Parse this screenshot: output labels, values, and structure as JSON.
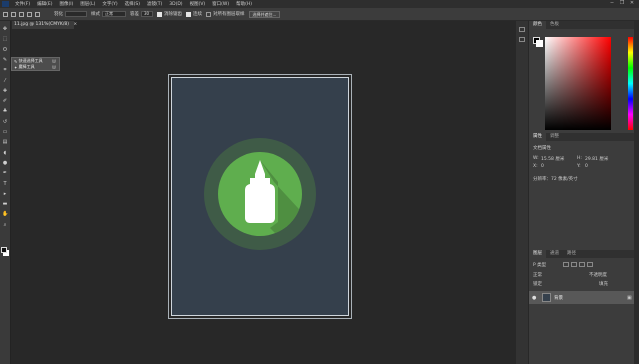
{
  "menubar": {
    "logo": "Ps",
    "items": [
      "文件(F)",
      "编辑(E)",
      "图像(I)",
      "图层(L)",
      "文字(Y)",
      "选择(S)",
      "滤镜(T)",
      "3D(D)",
      "视图(V)",
      "窗口(W)",
      "帮助(H)"
    ],
    "window_controls": [
      "─",
      "❐",
      "✕"
    ]
  },
  "options": {
    "style_label": "正常",
    "size_value": "30",
    "check1_label": "消除锯齿",
    "check2_label": "连续",
    "check3_label": "对所有图层取样",
    "button_label": "选择并遮住..."
  },
  "document": {
    "tab_title": "11.jpg @ 131%(CMYK/8)",
    "close": "×"
  },
  "tool_flyout": {
    "items": [
      {
        "label": "快速选择工具",
        "shortcut": "W"
      },
      {
        "label": "魔棒工具",
        "shortcut": "W"
      }
    ]
  },
  "panels": {
    "color_tabs": [
      "颜色",
      "色板"
    ],
    "properties_tabs": [
      "属性",
      "调整"
    ],
    "properties": {
      "section": "文档属性",
      "w_label": "W:",
      "w_value": "15.58 厘米",
      "h_label": "H:",
      "h_value": "29.81 厘米",
      "x_label": "X:",
      "x_value": "0",
      "y_label": "Y:",
      "y_value": "0",
      "resolution": "分辨率：72 像素/英寸"
    },
    "layers_tabs": [
      "图层",
      "通道",
      "路径"
    ],
    "layers": {
      "filter_label": "P 类型",
      "blend_mode": "正常",
      "opacity_label": "不透明度",
      "lock_label": "锁定",
      "fill_label": "填充",
      "layer_name": "背景",
      "eye": "👁",
      "lock": "🔒"
    }
  },
  "colors": {
    "artboard_bg": "#35404c",
    "circle_outer": "#3f5b47",
    "circle_inner": "#5fae4e",
    "long_shadow": "#4f8f41",
    "bottle": "#ffffff"
  },
  "icons": {
    "toolbar": [
      "move-icon",
      "marquee-icon",
      "lasso-icon",
      "quick-select-icon",
      "crop-icon",
      "eyedropper-icon",
      "heal-icon",
      "brush-icon",
      "stamp-icon",
      "history-brush-icon",
      "eraser-icon",
      "gradient-icon",
      "blur-icon",
      "dodge-icon",
      "pen-icon",
      "type-icon",
      "path-select-icon",
      "shape-icon",
      "hand-icon",
      "zoom-icon"
    ]
  }
}
